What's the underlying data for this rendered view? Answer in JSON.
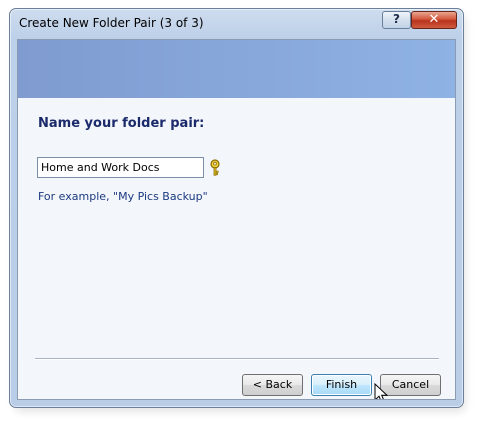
{
  "window": {
    "title": "Create New Folder Pair (3 of 3)",
    "help_label": "?",
    "close_label": "✕"
  },
  "banner": {
    "color_start": "#7f9bd0",
    "color_end": "#8fb2e4"
  },
  "form": {
    "heading": "Name your folder pair:",
    "name_value": "Home and Work Docs",
    "hint_icon": "key-icon",
    "example": "For example, \"My Pics Backup\""
  },
  "buttons": {
    "back": "< Back",
    "finish": "Finish",
    "cancel": "Cancel"
  }
}
